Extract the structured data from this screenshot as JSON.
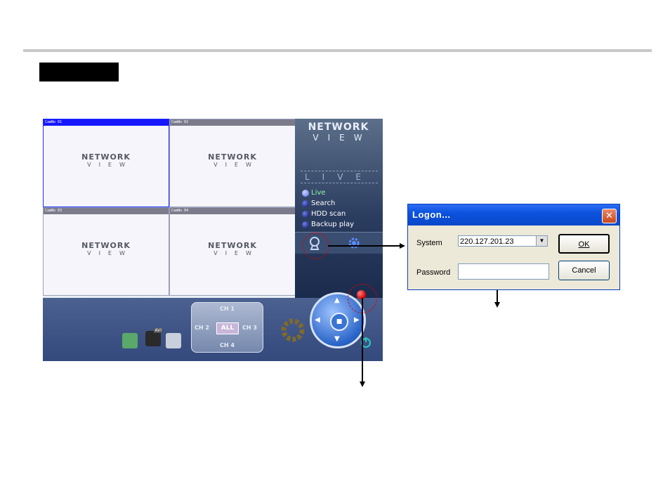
{
  "app": {
    "cameras": [
      {
        "label": "CamNo 01"
      },
      {
        "label": "CamNo 02"
      },
      {
        "label": "CamNo 03"
      },
      {
        "label": "CamNo 04"
      }
    ],
    "cam_logo_top": "NETWORK",
    "cam_logo_bottom": "VIEW",
    "panel_logo_top": "NETWORK",
    "panel_logo_bottom": "VIEW",
    "panel_mode": "LIVE",
    "menu": [
      {
        "label": "Live",
        "active": true
      },
      {
        "label": "Search"
      },
      {
        "label": "HDD scan"
      },
      {
        "label": "Backup play"
      }
    ],
    "channel_pad": {
      "top": "CH 1",
      "left": "CH 2",
      "right": "CH 3",
      "bottom": "CH 4",
      "center": "ALL"
    },
    "avi_badge": "AVI"
  },
  "dialog": {
    "title": "Logon...",
    "system_label": "System",
    "system_value": "220.127.201.23",
    "password_label": "Password",
    "password_value": "",
    "ok_label": "OK",
    "cancel_label": "Cancel"
  },
  "colors": {
    "selected_cam": "#1616ff",
    "callout": "#e00000",
    "dialog_title": "#0b52dd"
  }
}
